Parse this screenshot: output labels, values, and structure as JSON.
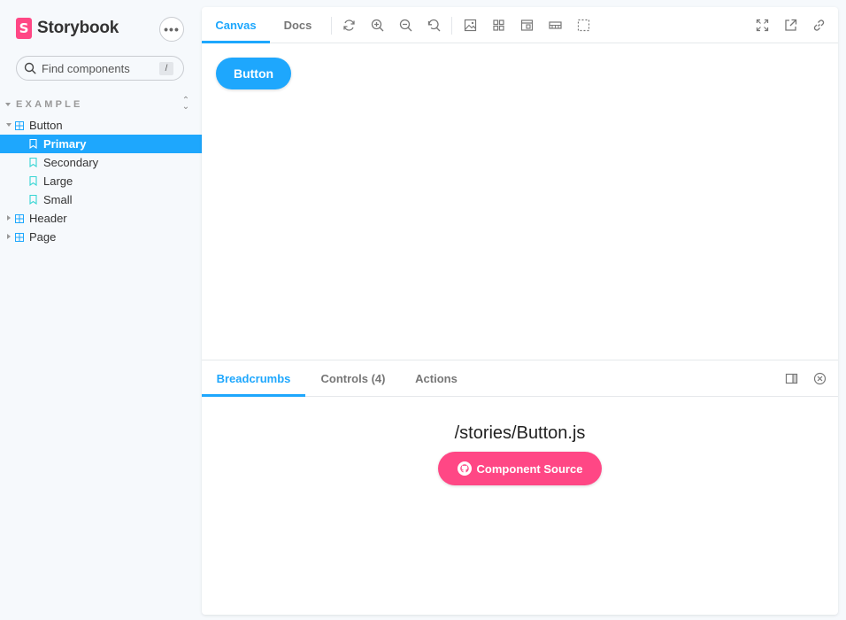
{
  "brand": {
    "name": "Storybook",
    "logo_letter": "S",
    "accent": "#ff4785"
  },
  "search": {
    "placeholder": "Find components",
    "shortcut": "/"
  },
  "sidebar": {
    "section_label": "EXAMPLE",
    "items": [
      {
        "label": "Button",
        "type": "component",
        "expanded": true
      },
      {
        "label": "Primary",
        "type": "story",
        "selected": true
      },
      {
        "label": "Secondary",
        "type": "story"
      },
      {
        "label": "Large",
        "type": "story"
      },
      {
        "label": "Small",
        "type": "story"
      },
      {
        "label": "Header",
        "type": "component",
        "expanded": false
      },
      {
        "label": "Page",
        "type": "component",
        "expanded": false
      }
    ]
  },
  "toolbar": {
    "tabs": [
      {
        "label": "Canvas",
        "active": true
      },
      {
        "label": "Docs"
      }
    ],
    "tools": [
      "reload-icon",
      "zoom-in-icon",
      "zoom-out-icon",
      "zoom-reset-icon",
      "background-icon",
      "grid-icon",
      "viewport-icon",
      "measure-icon",
      "outline-icon",
      "fullscreen-icon",
      "open-new-tab-icon",
      "copy-link-icon"
    ]
  },
  "canvas": {
    "button_label": "Button"
  },
  "addons": {
    "tabs": [
      {
        "label": "Breadcrumbs",
        "active": true
      },
      {
        "label": "Controls (4)"
      },
      {
        "label": "Actions"
      }
    ],
    "path": "/stories/Button.js",
    "source_button": "Component Source"
  },
  "colors": {
    "primary": "#1ea7fd",
    "secondary": "#ff4785",
    "text": "#333333"
  }
}
